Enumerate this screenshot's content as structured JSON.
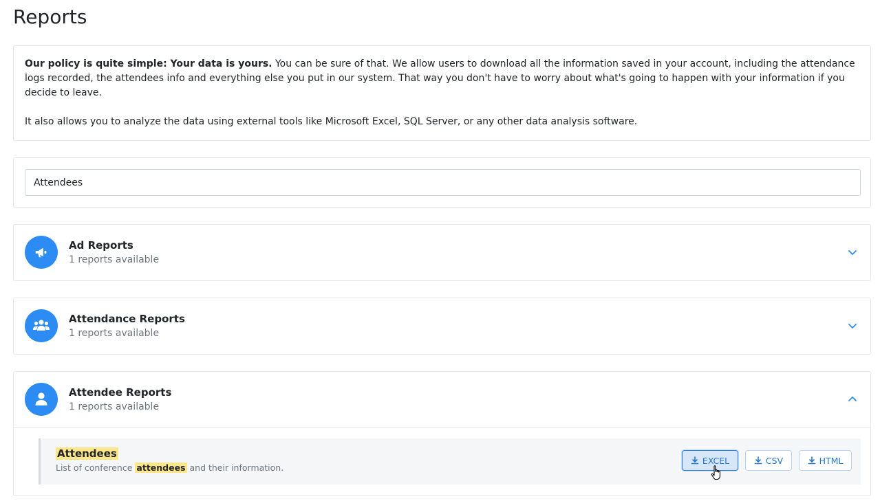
{
  "page": {
    "title": "Reports"
  },
  "policy": {
    "bold_lead": "Our policy is quite simple: Your data is yours.",
    "paragraph_1_rest": " You can be sure of that. We allow users to download all the information saved in your account, including the attendance logs recorded, the attendees info and everything else you put in our system. That way you don't have to worry about what's going to happen with your information if you decide to leave.",
    "paragraph_2": "It also allows you to analyze the data using external tools like Microsoft Excel, SQL Server, or any other data analysis software."
  },
  "search": {
    "value": "Attendees"
  },
  "sections": [
    {
      "title": "Ad Reports",
      "subtitle": "1 reports available",
      "icon": "megaphone-icon",
      "expanded": false
    },
    {
      "title": "Attendance Reports",
      "subtitle": "1 reports available",
      "icon": "users-icon",
      "expanded": false
    },
    {
      "title": "Attendee Reports",
      "subtitle": "1 reports available",
      "icon": "user-icon",
      "expanded": true
    }
  ],
  "report": {
    "title": "Attendees",
    "desc_before": "List of conference ",
    "desc_highlight": "attendees",
    "desc_after": " and their information.",
    "buttons": {
      "excel": "EXCEL",
      "csv": "CSV",
      "html": "HTML"
    }
  },
  "colors": {
    "accent": "#2c8cf4",
    "highlight": "#fde68a",
    "button_text": "#2476d1"
  }
}
